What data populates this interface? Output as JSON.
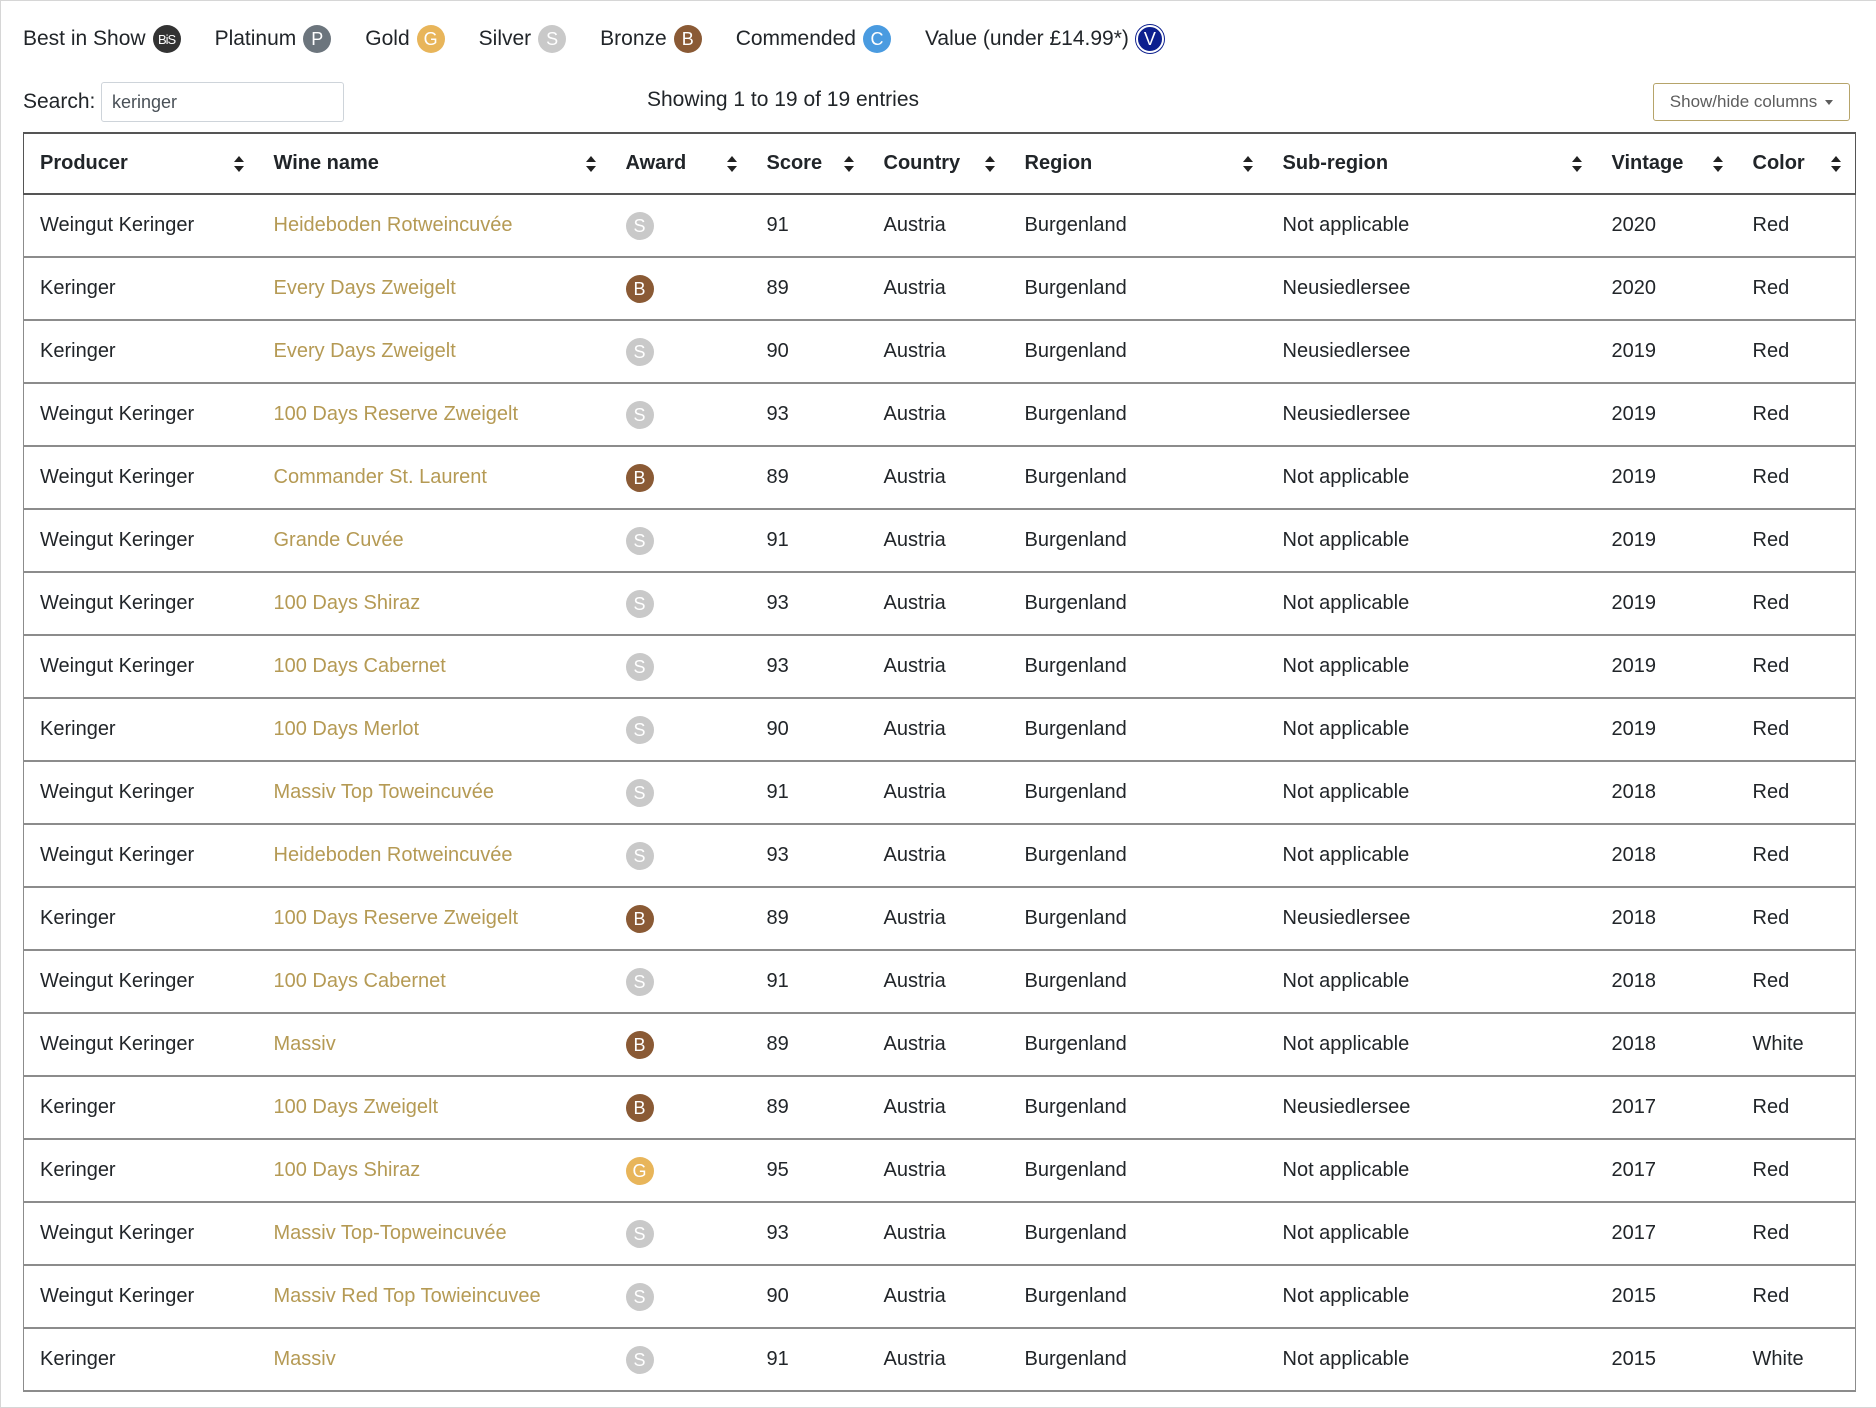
{
  "legend": [
    {
      "label": "Best in Show",
      "badge": "BiS",
      "cls": "b-bis"
    },
    {
      "label": "Platinum",
      "badge": "P",
      "cls": "b-p"
    },
    {
      "label": "Gold",
      "badge": "G",
      "cls": "b-g"
    },
    {
      "label": "Silver",
      "badge": "S",
      "cls": "b-s"
    },
    {
      "label": "Bronze",
      "badge": "B",
      "cls": "b-b"
    },
    {
      "label": "Commended",
      "badge": "C",
      "cls": "b-c"
    },
    {
      "label": "Value (under £14.99*)",
      "badge": "V",
      "cls": "b-v"
    }
  ],
  "search": {
    "label": "Search:",
    "value": "keringer"
  },
  "info": "Showing 1 to 19 of 19 entries",
  "colvis_label": "Show/hide columns",
  "columns": [
    "Producer",
    "Wine name",
    "Award",
    "Score",
    "Country",
    "Region",
    "Sub-region",
    "Vintage",
    "Color"
  ],
  "award_classes": {
    "S": "b-s",
    "B": "b-b",
    "G": "b-g"
  },
  "rows": [
    {
      "producer": "Weingut Keringer",
      "wine": "Heideboden Rotweincuvée",
      "award": "S",
      "score": "91",
      "country": "Austria",
      "region": "Burgenland",
      "subregion": "Not applicable",
      "vintage": "2020",
      "color": "Red"
    },
    {
      "producer": "Keringer",
      "wine": "Every Days Zweigelt",
      "award": "B",
      "score": "89",
      "country": "Austria",
      "region": "Burgenland",
      "subregion": "Neusiedlersee",
      "vintage": "2020",
      "color": "Red"
    },
    {
      "producer": "Keringer",
      "wine": "Every Days Zweigelt",
      "award": "S",
      "score": "90",
      "country": "Austria",
      "region": "Burgenland",
      "subregion": "Neusiedlersee",
      "vintage": "2019",
      "color": "Red"
    },
    {
      "producer": "Weingut Keringer",
      "wine": "100 Days Reserve Zweigelt",
      "award": "S",
      "score": "93",
      "country": "Austria",
      "region": "Burgenland",
      "subregion": "Neusiedlersee",
      "vintage": "2019",
      "color": "Red"
    },
    {
      "producer": "Weingut Keringer",
      "wine": "Commander St. Laurent",
      "award": "B",
      "score": "89",
      "country": "Austria",
      "region": "Burgenland",
      "subregion": "Not applicable",
      "vintage": "2019",
      "color": "Red"
    },
    {
      "producer": "Weingut Keringer",
      "wine": "Grande Cuvée",
      "award": "S",
      "score": "91",
      "country": "Austria",
      "region": "Burgenland",
      "subregion": "Not applicable",
      "vintage": "2019",
      "color": "Red"
    },
    {
      "producer": "Weingut Keringer",
      "wine": "100 Days Shiraz",
      "award": "S",
      "score": "93",
      "country": "Austria",
      "region": "Burgenland",
      "subregion": "Not applicable",
      "vintage": "2019",
      "color": "Red"
    },
    {
      "producer": "Weingut Keringer",
      "wine": "100 Days Cabernet",
      "award": "S",
      "score": "93",
      "country": "Austria",
      "region": "Burgenland",
      "subregion": "Not applicable",
      "vintage": "2019",
      "color": "Red"
    },
    {
      "producer": "Keringer",
      "wine": "100 Days Merlot",
      "award": "S",
      "score": "90",
      "country": "Austria",
      "region": "Burgenland",
      "subregion": "Not applicable",
      "vintage": "2019",
      "color": "Red"
    },
    {
      "producer": "Weingut Keringer",
      "wine": "Massiv Top Toweincuvée",
      "award": "S",
      "score": "91",
      "country": "Austria",
      "region": "Burgenland",
      "subregion": "Not applicable",
      "vintage": "2018",
      "color": "Red"
    },
    {
      "producer": "Weingut Keringer",
      "wine": "Heideboden Rotweincuvée",
      "award": "S",
      "score": "93",
      "country": "Austria",
      "region": "Burgenland",
      "subregion": "Not applicable",
      "vintage": "2018",
      "color": "Red"
    },
    {
      "producer": "Keringer",
      "wine": "100 Days Reserve Zweigelt",
      "award": "B",
      "score": "89",
      "country": "Austria",
      "region": "Burgenland",
      "subregion": "Neusiedlersee",
      "vintage": "2018",
      "color": "Red"
    },
    {
      "producer": "Weingut Keringer",
      "wine": "100 Days Cabernet",
      "award": "S",
      "score": "91",
      "country": "Austria",
      "region": "Burgenland",
      "subregion": "Not applicable",
      "vintage": "2018",
      "color": "Red"
    },
    {
      "producer": "Weingut Keringer",
      "wine": "Massiv",
      "award": "B",
      "score": "89",
      "country": "Austria",
      "region": "Burgenland",
      "subregion": "Not applicable",
      "vintage": "2018",
      "color": "White"
    },
    {
      "producer": "Keringer",
      "wine": "100 Days Zweigelt",
      "award": "B",
      "score": "89",
      "country": "Austria",
      "region": "Burgenland",
      "subregion": "Neusiedlersee",
      "vintage": "2017",
      "color": "Red"
    },
    {
      "producer": "Keringer",
      "wine": "100 Days Shiraz",
      "award": "G",
      "score": "95",
      "country": "Austria",
      "region": "Burgenland",
      "subregion": "Not applicable",
      "vintage": "2017",
      "color": "Red"
    },
    {
      "producer": "Weingut Keringer",
      "wine": "Massiv Top-Topweincuvée",
      "award": "S",
      "score": "93",
      "country": "Austria",
      "region": "Burgenland",
      "subregion": "Not applicable",
      "vintage": "2017",
      "color": "Red"
    },
    {
      "producer": "Weingut Keringer",
      "wine": "Massiv Red Top Towieincuvee",
      "award": "S",
      "score": "90",
      "country": "Austria",
      "region": "Burgenland",
      "subregion": "Not applicable",
      "vintage": "2015",
      "color": "Red"
    },
    {
      "producer": "Keringer",
      "wine": "Massiv",
      "award": "S",
      "score": "91",
      "country": "Austria",
      "region": "Burgenland",
      "subregion": "Not applicable",
      "vintage": "2015",
      "color": "White"
    }
  ]
}
